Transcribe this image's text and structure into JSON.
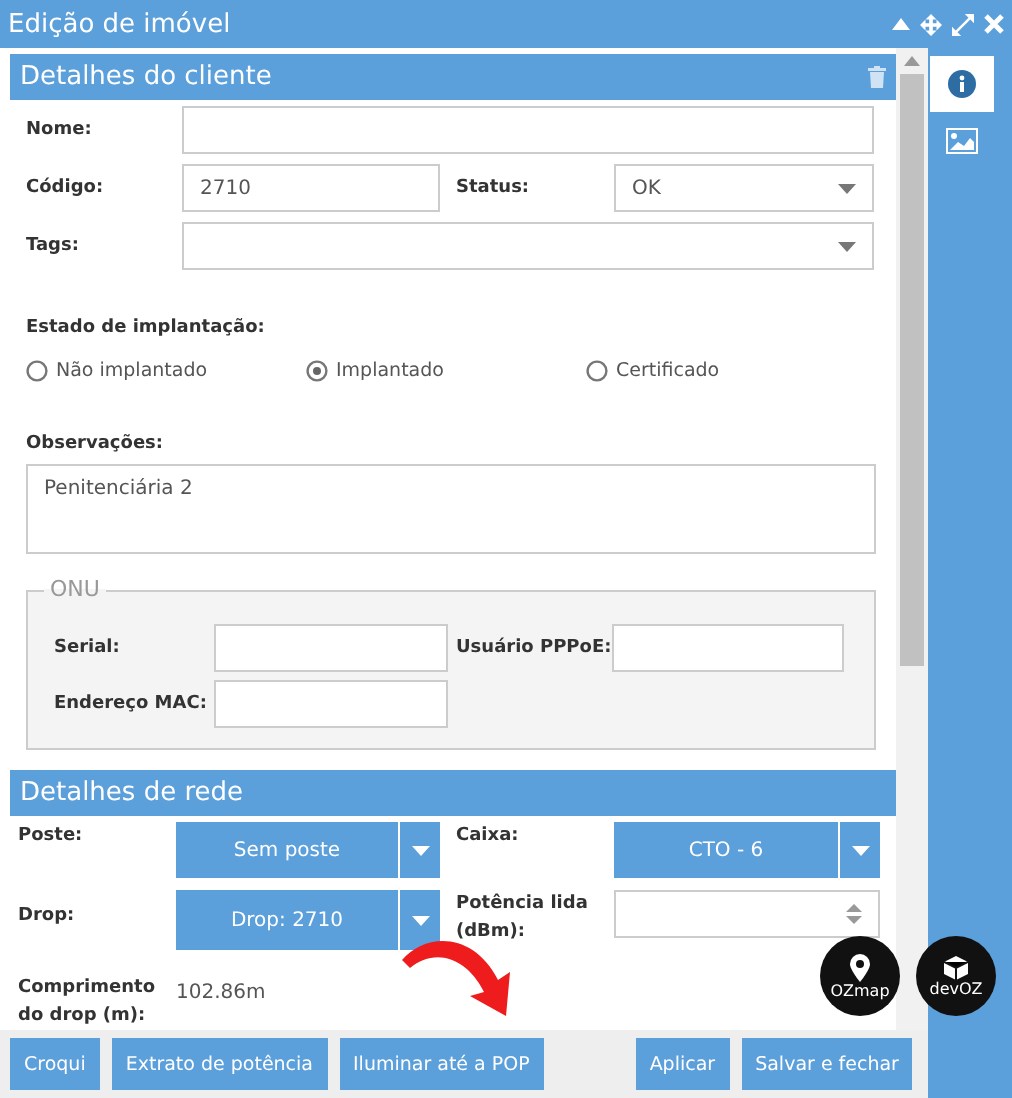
{
  "window": {
    "title": "Edição de imóvel"
  },
  "client_section": {
    "title": "Detalhes do cliente",
    "fields": [
      {
        "label": "Nome:"
      },
      {
        "label": "Código:",
        "value": "2710"
      },
      {
        "label": "Status:",
        "value": "OK"
      },
      {
        "label": "Tags:"
      }
    ],
    "deployment": {
      "label": "Estado de implantação:",
      "options": [
        {
          "label": "Não implantado",
          "selected": false
        },
        {
          "label": "Implantado",
          "selected": true
        },
        {
          "label": "Certificado",
          "selected": false
        }
      ]
    },
    "notes": {
      "label": "Observações:",
      "value": "Penitenciária 2"
    },
    "onu": {
      "legend": "ONU",
      "fields": [
        {
          "label": "Serial:"
        },
        {
          "label": "Usuário PPPoE:"
        },
        {
          "label": "Endereço MAC:"
        }
      ]
    }
  },
  "network_section": {
    "title": "Detalhes de rede",
    "pole": {
      "label": "Poste:",
      "value": "Sem poste"
    },
    "box": {
      "label": "Caixa:",
      "value": "CTO - 6"
    },
    "drop": {
      "label": "Drop:",
      "value": "Drop: 2710"
    },
    "power": {
      "label": "Potência lida (dBm):"
    },
    "length": {
      "label": "Comprimento do drop (m):",
      "value": "102.86m"
    }
  },
  "side_tabs": [
    {
      "kind": "info",
      "selected": true
    },
    {
      "kind": "image",
      "selected": false
    }
  ],
  "buttons": [
    "Croqui",
    "Extrato de potência",
    "Iluminar até a POP",
    "Aplicar",
    "Salvar e fechar"
  ],
  "logos": [
    {
      "kind": "pin",
      "label": "OZmap"
    },
    {
      "kind": "cube",
      "label": "devOZ"
    }
  ]
}
